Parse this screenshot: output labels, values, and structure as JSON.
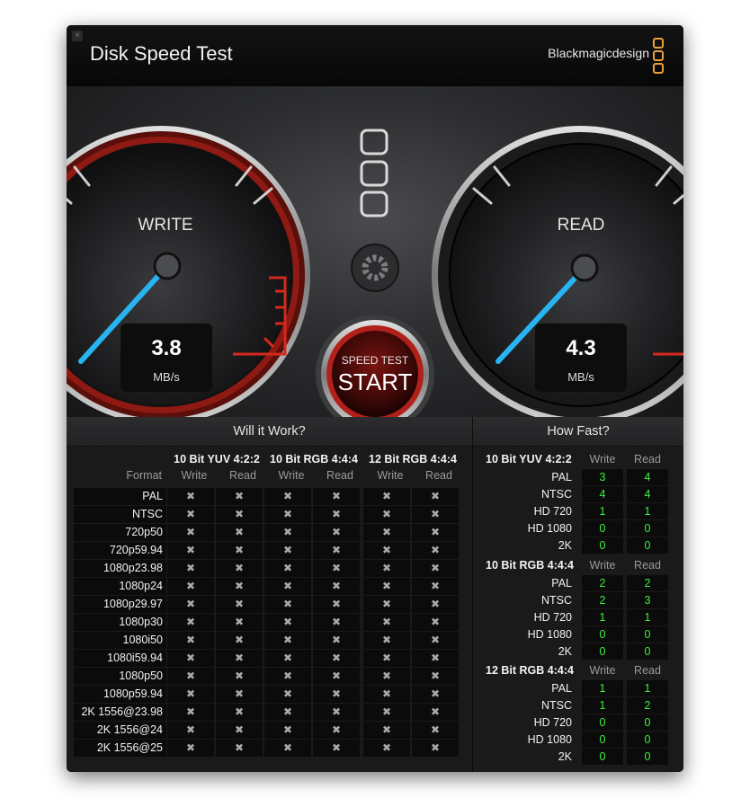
{
  "app": {
    "title": "Disk Speed Test",
    "brand": "Blackmagicdesign",
    "close_glyph": "×"
  },
  "gauges": {
    "write": {
      "label": "WRITE",
      "value": "3.8",
      "unit": "MB/s"
    },
    "read": {
      "label": "READ",
      "value": "4.3",
      "unit": "MB/s"
    }
  },
  "start_button": {
    "top": "SPEED TEST",
    "label": "START"
  },
  "icons": {
    "settings": "gear-icon",
    "drive_select": "square-icon",
    "close": "close-icon"
  },
  "colors": {
    "accent_blue": "#27b4f0",
    "accent_red": "#d5281e",
    "green_value": "#3ef03e",
    "brand_orange": "#e8a13c"
  },
  "will_it_work": {
    "title": "Will it Work?",
    "format_label": "Format",
    "groups": [
      "10 Bit YUV 4:2:2",
      "10 Bit RGB 4:4:4",
      "12 Bit RGB 4:4:4"
    ],
    "subcols": [
      "Write",
      "Read"
    ],
    "cell_glyph": "✖",
    "formats": [
      "PAL",
      "NTSC",
      "720p50",
      "720p59.94",
      "1080p23.98",
      "1080p24",
      "1080p29.97",
      "1080p30",
      "1080i50",
      "1080i59.94",
      "1080p50",
      "1080p59.94",
      "2K 1556@23.98",
      "2K 1556@24",
      "2K 1556@25"
    ]
  },
  "how_fast": {
    "title": "How Fast?",
    "subcols": [
      "Write",
      "Read"
    ],
    "groups": [
      {
        "name": "10 Bit YUV 4:2:2",
        "rows": [
          {
            "label": "PAL",
            "write": "3",
            "read": "4"
          },
          {
            "label": "NTSC",
            "write": "4",
            "read": "4"
          },
          {
            "label": "HD 720",
            "write": "1",
            "read": "1"
          },
          {
            "label": "HD 1080",
            "write": "0",
            "read": "0"
          },
          {
            "label": "2K",
            "write": "0",
            "read": "0"
          }
        ]
      },
      {
        "name": "10 Bit RGB 4:4:4",
        "rows": [
          {
            "label": "PAL",
            "write": "2",
            "read": "2"
          },
          {
            "label": "NTSC",
            "write": "2",
            "read": "3"
          },
          {
            "label": "HD 720",
            "write": "1",
            "read": "1"
          },
          {
            "label": "HD 1080",
            "write": "0",
            "read": "0"
          },
          {
            "label": "2K",
            "write": "0",
            "read": "0"
          }
        ]
      },
      {
        "name": "12 Bit RGB 4:4:4",
        "rows": [
          {
            "label": "PAL",
            "write": "1",
            "read": "1"
          },
          {
            "label": "NTSC",
            "write": "1",
            "read": "2"
          },
          {
            "label": "HD 720",
            "write": "0",
            "read": "0"
          },
          {
            "label": "HD 1080",
            "write": "0",
            "read": "0"
          },
          {
            "label": "2K",
            "write": "0",
            "read": "0"
          }
        ]
      }
    ]
  }
}
